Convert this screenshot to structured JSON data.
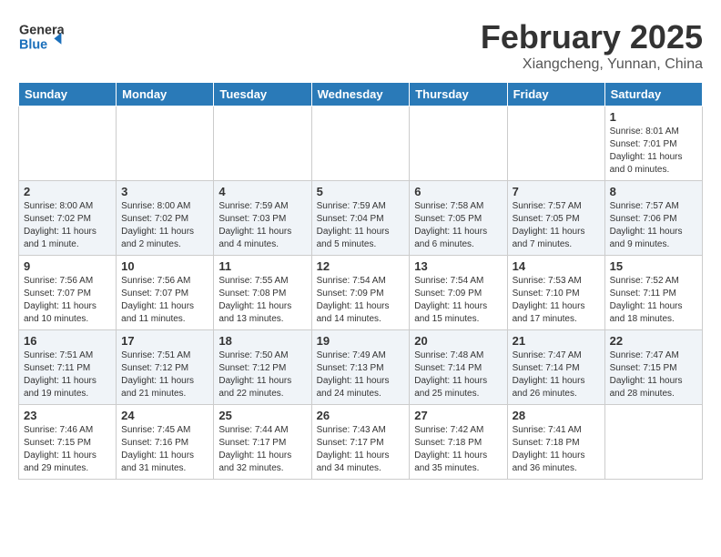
{
  "header": {
    "logo_general": "General",
    "logo_blue": "Blue",
    "month_title": "February 2025",
    "subtitle": "Xiangcheng, Yunnan, China"
  },
  "weekdays": [
    "Sunday",
    "Monday",
    "Tuesday",
    "Wednesday",
    "Thursday",
    "Friday",
    "Saturday"
  ],
  "weeks": [
    [
      {
        "day": "",
        "info": ""
      },
      {
        "day": "",
        "info": ""
      },
      {
        "day": "",
        "info": ""
      },
      {
        "day": "",
        "info": ""
      },
      {
        "day": "",
        "info": ""
      },
      {
        "day": "",
        "info": ""
      },
      {
        "day": "1",
        "info": "Sunrise: 8:01 AM\nSunset: 7:01 PM\nDaylight: 11 hours\nand 0 minutes."
      }
    ],
    [
      {
        "day": "2",
        "info": "Sunrise: 8:00 AM\nSunset: 7:02 PM\nDaylight: 11 hours\nand 1 minute."
      },
      {
        "day": "3",
        "info": "Sunrise: 8:00 AM\nSunset: 7:02 PM\nDaylight: 11 hours\nand 2 minutes."
      },
      {
        "day": "4",
        "info": "Sunrise: 7:59 AM\nSunset: 7:03 PM\nDaylight: 11 hours\nand 4 minutes."
      },
      {
        "day": "5",
        "info": "Sunrise: 7:59 AM\nSunset: 7:04 PM\nDaylight: 11 hours\nand 5 minutes."
      },
      {
        "day": "6",
        "info": "Sunrise: 7:58 AM\nSunset: 7:05 PM\nDaylight: 11 hours\nand 6 minutes."
      },
      {
        "day": "7",
        "info": "Sunrise: 7:57 AM\nSunset: 7:05 PM\nDaylight: 11 hours\nand 7 minutes."
      },
      {
        "day": "8",
        "info": "Sunrise: 7:57 AM\nSunset: 7:06 PM\nDaylight: 11 hours\nand 9 minutes."
      }
    ],
    [
      {
        "day": "9",
        "info": "Sunrise: 7:56 AM\nSunset: 7:07 PM\nDaylight: 11 hours\nand 10 minutes."
      },
      {
        "day": "10",
        "info": "Sunrise: 7:56 AM\nSunset: 7:07 PM\nDaylight: 11 hours\nand 11 minutes."
      },
      {
        "day": "11",
        "info": "Sunrise: 7:55 AM\nSunset: 7:08 PM\nDaylight: 11 hours\nand 13 minutes."
      },
      {
        "day": "12",
        "info": "Sunrise: 7:54 AM\nSunset: 7:09 PM\nDaylight: 11 hours\nand 14 minutes."
      },
      {
        "day": "13",
        "info": "Sunrise: 7:54 AM\nSunset: 7:09 PM\nDaylight: 11 hours\nand 15 minutes."
      },
      {
        "day": "14",
        "info": "Sunrise: 7:53 AM\nSunset: 7:10 PM\nDaylight: 11 hours\nand 17 minutes."
      },
      {
        "day": "15",
        "info": "Sunrise: 7:52 AM\nSunset: 7:11 PM\nDaylight: 11 hours\nand 18 minutes."
      }
    ],
    [
      {
        "day": "16",
        "info": "Sunrise: 7:51 AM\nSunset: 7:11 PM\nDaylight: 11 hours\nand 19 minutes."
      },
      {
        "day": "17",
        "info": "Sunrise: 7:51 AM\nSunset: 7:12 PM\nDaylight: 11 hours\nand 21 minutes."
      },
      {
        "day": "18",
        "info": "Sunrise: 7:50 AM\nSunset: 7:12 PM\nDaylight: 11 hours\nand 22 minutes."
      },
      {
        "day": "19",
        "info": "Sunrise: 7:49 AM\nSunset: 7:13 PM\nDaylight: 11 hours\nand 24 minutes."
      },
      {
        "day": "20",
        "info": "Sunrise: 7:48 AM\nSunset: 7:14 PM\nDaylight: 11 hours\nand 25 minutes."
      },
      {
        "day": "21",
        "info": "Sunrise: 7:47 AM\nSunset: 7:14 PM\nDaylight: 11 hours\nand 26 minutes."
      },
      {
        "day": "22",
        "info": "Sunrise: 7:47 AM\nSunset: 7:15 PM\nDaylight: 11 hours\nand 28 minutes."
      }
    ],
    [
      {
        "day": "23",
        "info": "Sunrise: 7:46 AM\nSunset: 7:15 PM\nDaylight: 11 hours\nand 29 minutes."
      },
      {
        "day": "24",
        "info": "Sunrise: 7:45 AM\nSunset: 7:16 PM\nDaylight: 11 hours\nand 31 minutes."
      },
      {
        "day": "25",
        "info": "Sunrise: 7:44 AM\nSunset: 7:17 PM\nDaylight: 11 hours\nand 32 minutes."
      },
      {
        "day": "26",
        "info": "Sunrise: 7:43 AM\nSunset: 7:17 PM\nDaylight: 11 hours\nand 34 minutes."
      },
      {
        "day": "27",
        "info": "Sunrise: 7:42 AM\nSunset: 7:18 PM\nDaylight: 11 hours\nand 35 minutes."
      },
      {
        "day": "28",
        "info": "Sunrise: 7:41 AM\nSunset: 7:18 PM\nDaylight: 11 hours\nand 36 minutes."
      },
      {
        "day": "",
        "info": ""
      }
    ]
  ]
}
